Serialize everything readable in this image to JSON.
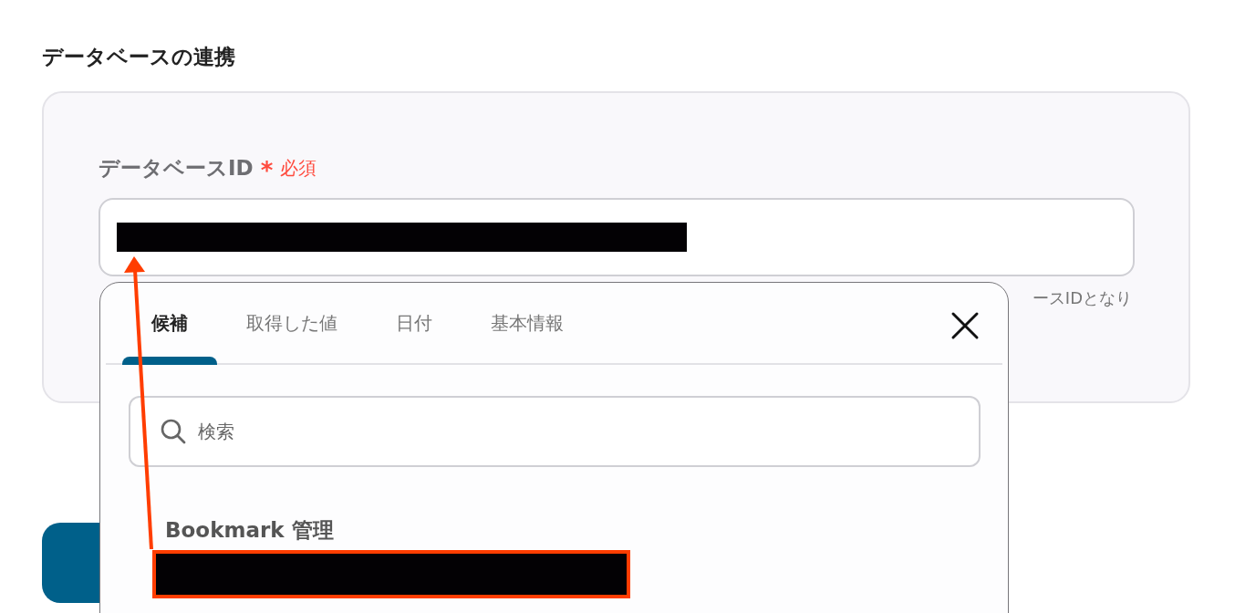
{
  "section": {
    "title": "データベースの連携"
  },
  "field": {
    "label": "データベースID",
    "required_mark": "*",
    "required_text": "必須",
    "help_text": "ースIDとなり"
  },
  "popup": {
    "tabs": [
      {
        "label": "候補",
        "selected": true
      },
      {
        "label": "取得した値",
        "selected": false
      },
      {
        "label": "日付",
        "selected": false
      },
      {
        "label": "基本情報",
        "selected": false
      }
    ],
    "search": {
      "placeholder": "検索"
    },
    "group_title": "Bookmark 管理"
  }
}
